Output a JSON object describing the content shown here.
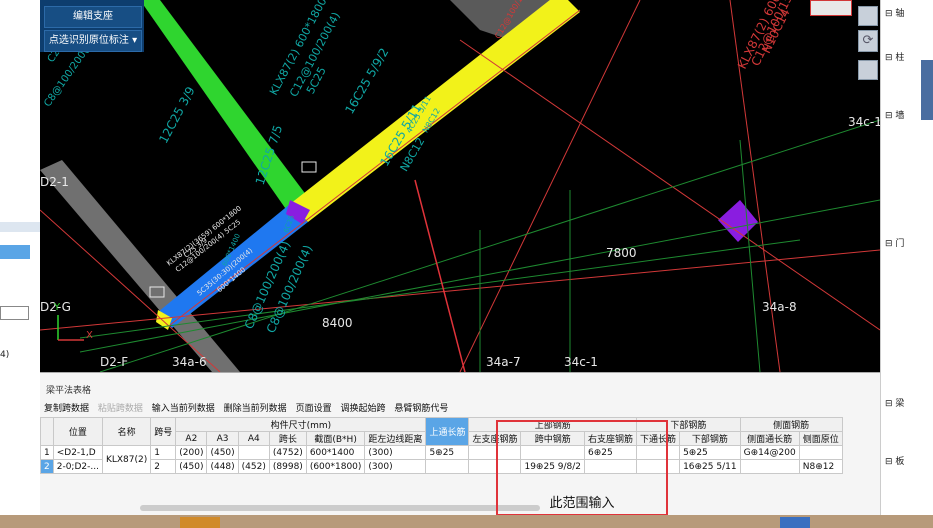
{
  "toolbar_top": {
    "edit_support": "编辑支座",
    "point_select": "点选识别原位标注"
  },
  "cad": {
    "labels_cyan": [
      "C25",
      "C8@100/200(4)",
      "12C25 3/9",
      "KLX87(2) 600*1800",
      "C12@100/200(4)",
      "5C25",
      "16C25 5/9/2",
      "4C25 5/11",
      "N8C12",
      "16C25 5/11",
      "N8C12",
      "12C25 7/5",
      "KLX87(2) 600*1400",
      "C12@100/150(4)",
      "N10C14",
      "KLX87(2)(3659) 600*1800",
      "C12@100/200(4) 5C25",
      "C25 3/9",
      "5C35(30:30)(200(4)",
      "600*1400",
      "C8@100/200(4)",
      "C8@100/200(4)",
      "C12@100/150(4)",
      "600*1400",
      "N10C14",
      "5C25",
      "6C25",
      "5C25"
    ],
    "labels_white": [
      "D2-1",
      "D2-G",
      "D2-F",
      "34a-6",
      "34a-7",
      "34c-1",
      "34a-8",
      "34c-1",
      "7800",
      "8400"
    ],
    "axis": {
      "x": "X",
      "y": "Y"
    }
  },
  "bottom": {
    "title": "梁平法表格",
    "tools": [
      "复制跨数据",
      "粘贴跨数据",
      "输入当前列数据",
      "删除当前列数据",
      "页面设置",
      "调换起始跨",
      "悬臂钢筋代号"
    ],
    "header": {
      "position": "位置",
      "name": "名称",
      "span_no": "跨号",
      "size_group": "构件尺寸(mm)",
      "A2": "A2",
      "A3": "A3",
      "A4": "A4",
      "span_length": "跨长",
      "section": "截面(B*H)",
      "dist_edge": "距左边线距离",
      "top_through": "上通长筋",
      "top_rebar": "上部钢筋",
      "left_support": "左支座钢筋",
      "mid_span": "跨中钢筋",
      "right_support": "右支座钢筋",
      "bottom_rebar": "下部钢筋",
      "bottom_through": "下通长筋",
      "bottom_bars": "下部钢筋",
      "side_rebar": "侧面钢筋",
      "side_through": "侧面通长筋",
      "side_orig": "侧面原位"
    },
    "rows": [
      {
        "idx": "1",
        "pos": "<D2-1,D",
        "name": "KLX87(2)",
        "span": "1",
        "a2": "(200)",
        "a3": "(450)",
        "a4": "",
        "len": "(4752)",
        "sec": "600*1400",
        "dist": "(300)",
        "top": "5⊕25",
        "left": "",
        "mid": "",
        "right": "6⊕25",
        "bthrough": "",
        "bbars": "5⊕25",
        "sthrough": "G⊕14@200",
        "sorig": ""
      },
      {
        "idx": "2",
        "pos": "2-0;D2-...",
        "name": "",
        "span": "2",
        "a2": "(450)",
        "a3": "(448)",
        "a4": "(452)",
        "len": "(8998)",
        "sec": "(600*1800)",
        "dist": "(300)",
        "top": "",
        "left": "",
        "mid": "19⊕25 9/8/2",
        "right": "",
        "bthrough": "",
        "bbars": "16⊕25 5/11",
        "sthrough": "",
        "sorig": "N8⊕12"
      }
    ],
    "annotation": "此范围输入"
  },
  "right_panel": {
    "items": [
      "轴",
      "柱",
      "墙",
      "门",
      "梁",
      "板"
    ]
  },
  "left_panel": {
    "fragment": "4)"
  },
  "colors": {
    "beam_yellow": "#f2f21a",
    "beam_blue": "#1f78f0",
    "beam_green": "#2fd52f",
    "selected_cell": "#5aa5e6",
    "highlight_box": "#e0333a",
    "purple_mark": "#8a1de0"
  }
}
